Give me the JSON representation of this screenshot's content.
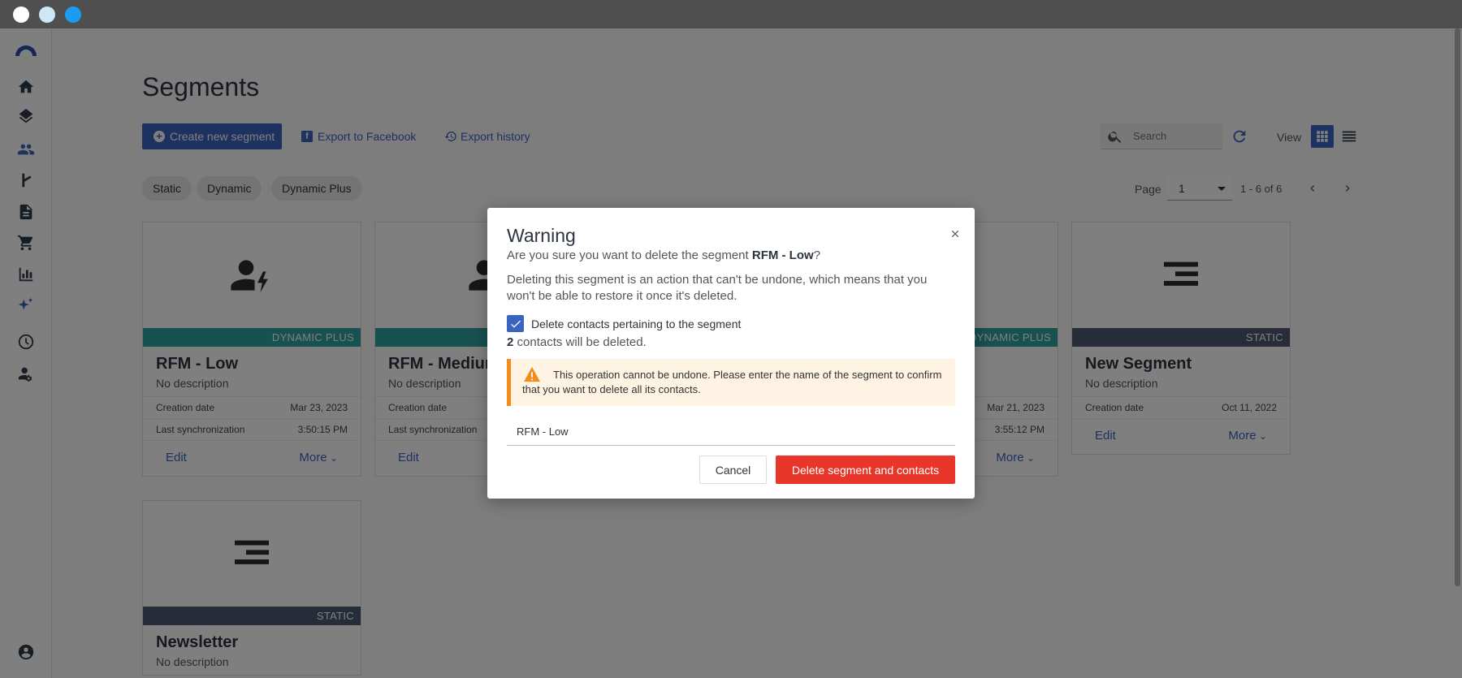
{
  "page": {
    "title": "Segments"
  },
  "toolbar": {
    "create_label": "Create new segment",
    "facebook_label": "Export to Facebook",
    "history_label": "Export history",
    "search_placeholder": "Search",
    "view_label": "View"
  },
  "filters": [
    "Static",
    "Dynamic",
    "Dynamic Plus"
  ],
  "pagination": {
    "page_label": "Page",
    "page_value": "1",
    "range_text": "1 - 6 of 6"
  },
  "cards": [
    {
      "title": "RFM - Low",
      "type": "DYNAMIC PLUS",
      "description": "No description",
      "creation_label": "Creation date",
      "creation_date": "Mar 23, 2023",
      "sync_label": "Last synchronization",
      "sync_time": "3:50:15 PM",
      "edit": "Edit",
      "more": "More"
    },
    {
      "title": "RFM - Medium",
      "description": "No description",
      "creation_label": "Creation date",
      "sync_label": "Last synchronization",
      "edit": "Edit"
    },
    {
      "type": "DYNAMIC PLUS",
      "creation_date": "Mar 21, 2023",
      "sync_time": "3:55:12 PM",
      "more": "More"
    },
    {
      "title": "New Segment",
      "type": "STATIC",
      "description": "No description",
      "creation_label": "Creation date",
      "creation_date": "Oct 11, 2022",
      "edit": "Edit",
      "more": "More"
    },
    {
      "title": "Newsletter",
      "type": "STATIC",
      "description": "No description"
    }
  ],
  "modal": {
    "title": "Warning",
    "question_prefix": "Are you sure you want to delete the segment ",
    "segment_name": "RFM - Low",
    "question_suffix": "?",
    "body": "Deleting this segment is an action that can't be undone, which means that you won't be able to restore it once it's deleted.",
    "checkbox_label": "Delete contacts pertaining to the segment",
    "checkbox_checked": true,
    "count": "2",
    "count_suffix": " contacts will be deleted.",
    "warning_text": "This operation cannot be undone. Please enter the name of the segment to confirm that you want to delete all its contacts.",
    "input_value": "RFM - Low",
    "cancel_label": "Cancel",
    "delete_label": "Delete segment and contacts"
  },
  "colors": {
    "accent": "#3b64c0",
    "danger": "#e8372a",
    "dynamic_band": "#2fa3a0",
    "static_band": "#4d5b73",
    "warning": "#f28c1a"
  },
  "icons": [
    "logo-icon",
    "home-icon",
    "layers-icon",
    "people-icon",
    "flow-icon",
    "document-icon",
    "cart-icon",
    "chart-icon",
    "sparkle-icon",
    "gauge-icon",
    "user-settings-icon",
    "account-icon"
  ]
}
